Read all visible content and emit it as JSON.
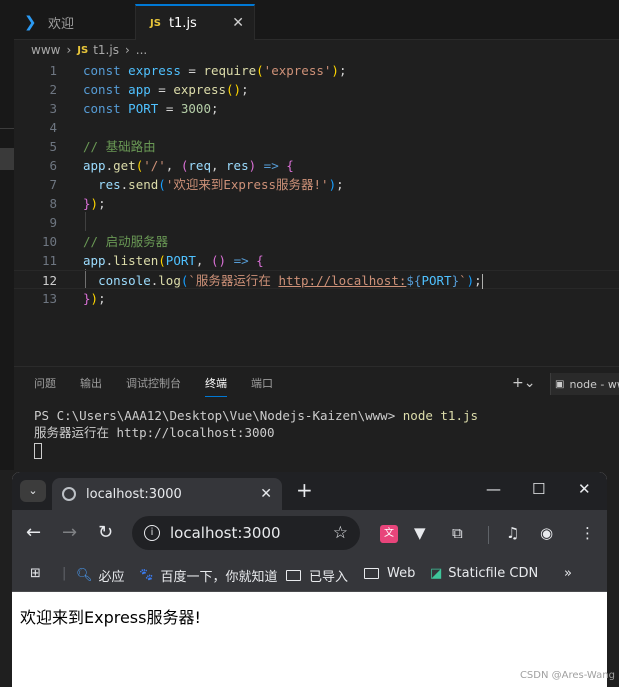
{
  "editor": {
    "tabs": [
      {
        "label": "欢迎"
      },
      {
        "label": "t1.js"
      }
    ],
    "breadcrumb": [
      "www",
      "t1.js",
      "..."
    ],
    "lines": [
      {
        "n": "1",
        "html": "<span class=\"kw\">const</span> <span class=\"var\">express</span> <span class=\"txt\">=</span> <span class=\"fn\">require</span><span class=\"p1\">(</span><span class=\"str\">'express'</span><span class=\"p1\">)</span><span class=\"txt\">;</span>"
      },
      {
        "n": "2",
        "html": "<span class=\"kw\">const</span> <span class=\"var\">app</span> <span class=\"txt\">=</span> <span class=\"fn\">express</span><span class=\"p1\">()</span><span class=\"txt\">;</span>"
      },
      {
        "n": "3",
        "html": "<span class=\"kw\">const</span> <span class=\"var\">PORT</span> <span class=\"txt\">=</span> <span class=\"num\">3000</span><span class=\"txt\">;</span>"
      },
      {
        "n": "4",
        "html": ""
      },
      {
        "n": "5",
        "html": "<span class=\"cm\">// 基础路由</span>"
      },
      {
        "n": "6",
        "html": "<span class=\"vr\">app</span><span class=\"txt\">.</span><span class=\"fn\">get</span><span class=\"p1\">(</span><span class=\"str\">'/'</span><span class=\"txt\">, </span><span class=\"p2\">(</span><span class=\"vr\">req</span><span class=\"txt\">, </span><span class=\"vr\">res</span><span class=\"p2\">)</span> <span class=\"kw\">=&gt;</span> <span class=\"p2\">{</span>"
      },
      {
        "n": "7",
        "html": "  <span class=\"vr\">res</span><span class=\"txt\">.</span><span class=\"fn\">send</span><span class=\"p3\">(</span><span class=\"str\">'欢迎来到Express服务器!'</span><span class=\"p3\">)</span><span class=\"txt\">;</span>"
      },
      {
        "n": "8",
        "html": "<span class=\"p2\">}</span><span class=\"p1\">)</span><span class=\"txt\">;</span>"
      },
      {
        "n": "9",
        "html": ""
      },
      {
        "n": "10",
        "html": "<span class=\"cm\">// 启动服务器</span>"
      },
      {
        "n": "11",
        "html": "<span class=\"vr\">app</span><span class=\"txt\">.</span><span class=\"fn\">listen</span><span class=\"p1\">(</span><span class=\"var\">PORT</span><span class=\"txt\">, </span><span class=\"p2\">()</span> <span class=\"kw\">=&gt;</span> <span class=\"p2\">{</span>"
      },
      {
        "n": "12",
        "html": "  <span class=\"vr\">console</span><span class=\"txt\">.</span><span class=\"fn\">log</span><span class=\"p3\">(</span><span class=\"str\">`服务器运行在 </span><span class=\"link\">http://localhost:</span><span class=\"dollar\">${</span><span class=\"var\">PORT</span><span class=\"dollar\">}</span><span class=\"str\">`</span><span class=\"p3\">)</span><span class=\"txt\">;</span><span class=\"cursor\"></span>"
      },
      {
        "n": "13",
        "html": "<span class=\"p2\">}</span><span class=\"p1\">)</span><span class=\"txt\">;</span>"
      }
    ]
  },
  "panel": {
    "tabs": [
      "问题",
      "输出",
      "调试控制台",
      "终端",
      "端口"
    ],
    "active_tab": "终端",
    "tools": "+⌄",
    "terminal_name": "node - www",
    "prompt": "PS C:\\Users\\AAA12\\Desktop\\Vue\\Nodejs-Kaizen\\www>",
    "command": "node t1.js",
    "output": "服务器运行在 http://localhost:3000"
  },
  "browser": {
    "tab_title": "localhost:3000",
    "url": "localhost:3000",
    "bookmarks": [
      "必应",
      "百度一下，你就知道",
      "已导入",
      "Web",
      "Staticfile CDN"
    ],
    "page_text": "欢迎来到Express服务器!"
  },
  "watermark": "CSDN @Ares-Wang"
}
